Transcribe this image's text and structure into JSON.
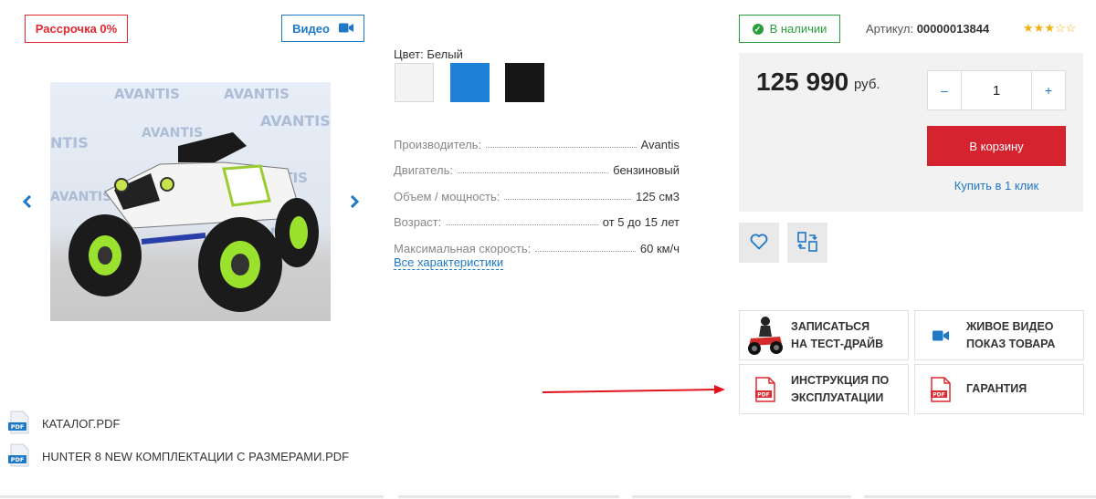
{
  "badges": {
    "installment": "Рассрочка 0%",
    "video": "Видео"
  },
  "gallery": {
    "prev_icon": "chevron-left-icon",
    "next_icon": "chevron-right-icon",
    "image_alt": "квадроцикл"
  },
  "color": {
    "label": "Цвет: Белый",
    "swatches": [
      {
        "name": "white",
        "hex": "#f4f4f4"
      },
      {
        "name": "blue",
        "hex": "#1e80d6"
      },
      {
        "name": "black",
        "hex": "#171717"
      }
    ]
  },
  "specs": [
    {
      "label": "Производитель:",
      "value": "Avantis"
    },
    {
      "label": "Двигатель:",
      "value": "бензиновый"
    },
    {
      "label": "Объем / мощность:",
      "value": "125 см3"
    },
    {
      "label": "Возраст:",
      "value": "от 5 до 15 лет"
    },
    {
      "label": "Максимальная скорость:",
      "value": "60 км/ч"
    }
  ],
  "all_specs_link": "Все характеристики",
  "stock": {
    "status": "В наличии",
    "article_label": "Артикул:",
    "article_value": "00000013844",
    "rating": 3,
    "rating_max": 5
  },
  "purchase": {
    "price": "125 990",
    "currency": "руб.",
    "qty_minus": "–",
    "qty_value": "1",
    "qty_plus": "+",
    "cart_button": "В корзину",
    "one_click": "Купить в 1 клик"
  },
  "services": [
    {
      "line1": "Записаться",
      "line2": "на тест-драйв",
      "icon": "atv-rider-icon"
    },
    {
      "line1": "Живое видео",
      "line2": "показ товара",
      "icon": "video-camera-icon"
    },
    {
      "line1": "Инструкция по",
      "line2": "эксплуатации",
      "icon": "pdf-icon"
    },
    {
      "line1": "Гарантия",
      "line2": "",
      "icon": "pdf-icon"
    }
  ],
  "files": [
    {
      "name": "Каталог.pdf",
      "icon": "pdf-file-icon"
    },
    {
      "name": "HUNTER 8 NEW комплектации с размерами.pdf",
      "icon": "pdf-file-icon"
    }
  ],
  "colors": {
    "accent": "#1e78c8",
    "red": "#d5242f",
    "green": "#2a9d3c",
    "star": "#f2b20d"
  }
}
